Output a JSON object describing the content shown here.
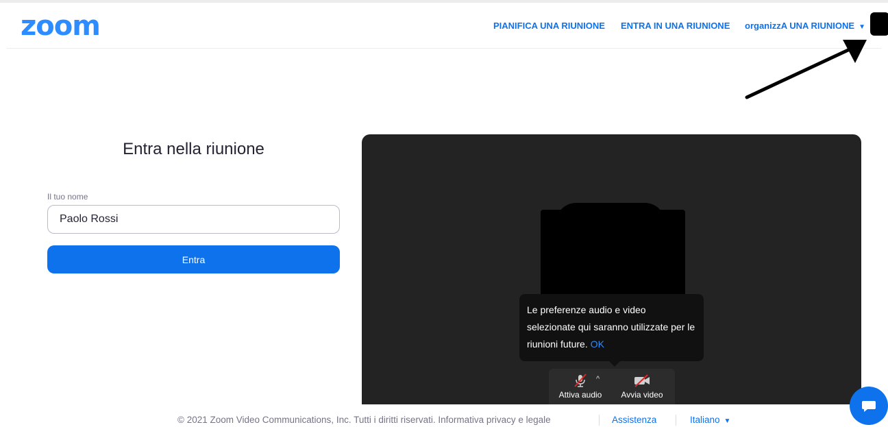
{
  "header": {
    "logo": "zoom",
    "nav": {
      "schedule": "PIANIFICA UNA RIUNIONE",
      "join": "ENTRA IN UNA RIUNIONE",
      "host": "organizzA UNA RIUNIONE"
    }
  },
  "join_form": {
    "title": "Entra nella riunione",
    "name_label": "Il tuo nome",
    "name_value": "Paolo Rossi",
    "submit_label": "Entra"
  },
  "preview": {
    "tooltip_text": "Le preferenze audio e video selezionate qui saranno utilizzate per le riunioni future.",
    "tooltip_ok": "OK",
    "audio_label": "Attiva audio",
    "video_label": "Avvia video"
  },
  "footer": {
    "copyright": "© 2021 Zoom Video Communications, Inc. Tutti i diritti riservati. Informativa privacy e legale",
    "support": "Assistenza",
    "language": "Italiano"
  },
  "colors": {
    "accent": "#0e72ed",
    "logo": "#2d8cff",
    "preview_bg": "#232323"
  },
  "icons": [
    "muted-microphone-icon",
    "chevron-up-icon",
    "video-off-icon",
    "chat-icon",
    "chevron-down-icon"
  ]
}
